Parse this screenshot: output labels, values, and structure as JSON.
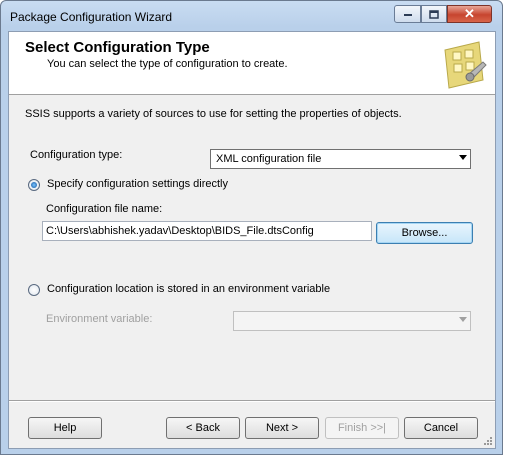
{
  "window": {
    "title": "Package Configuration Wizard",
    "minimize_icon": "minimize-icon",
    "maximize_icon": "maximize-icon",
    "close_icon": "close-icon",
    "close_glyph": "✕"
  },
  "header": {
    "title": "Select Configuration Type",
    "subtitle": "You can select the type of configuration to create.",
    "image_icon": "wizard-config-icon"
  },
  "body": {
    "intro": "SSIS supports a variety of sources to use for setting the properties of objects.",
    "config_type_label": "Configuration type:",
    "config_type_value": "XML configuration file",
    "option_direct": {
      "label": "Specify configuration settings directly",
      "checked": true
    },
    "file_name_label": "Configuration file name:",
    "file_name_value": "C:\\Users\\abhishek.yadav\\Desktop\\BIDS_File.dtsConfig",
    "browse_label": "Browse...",
    "option_env": {
      "label": "Configuration location is stored in an environment variable",
      "checked": false
    },
    "env_var_label": "Environment variable:",
    "env_var_value": ""
  },
  "footer": {
    "help": "Help",
    "back": "< Back",
    "next": "Next >",
    "finish": "Finish >>|",
    "cancel": "Cancel"
  },
  "colors": {
    "title_bar": "#b9d0ea",
    "close_button": "#c7452f",
    "focus_border": "#3c7fb1"
  }
}
